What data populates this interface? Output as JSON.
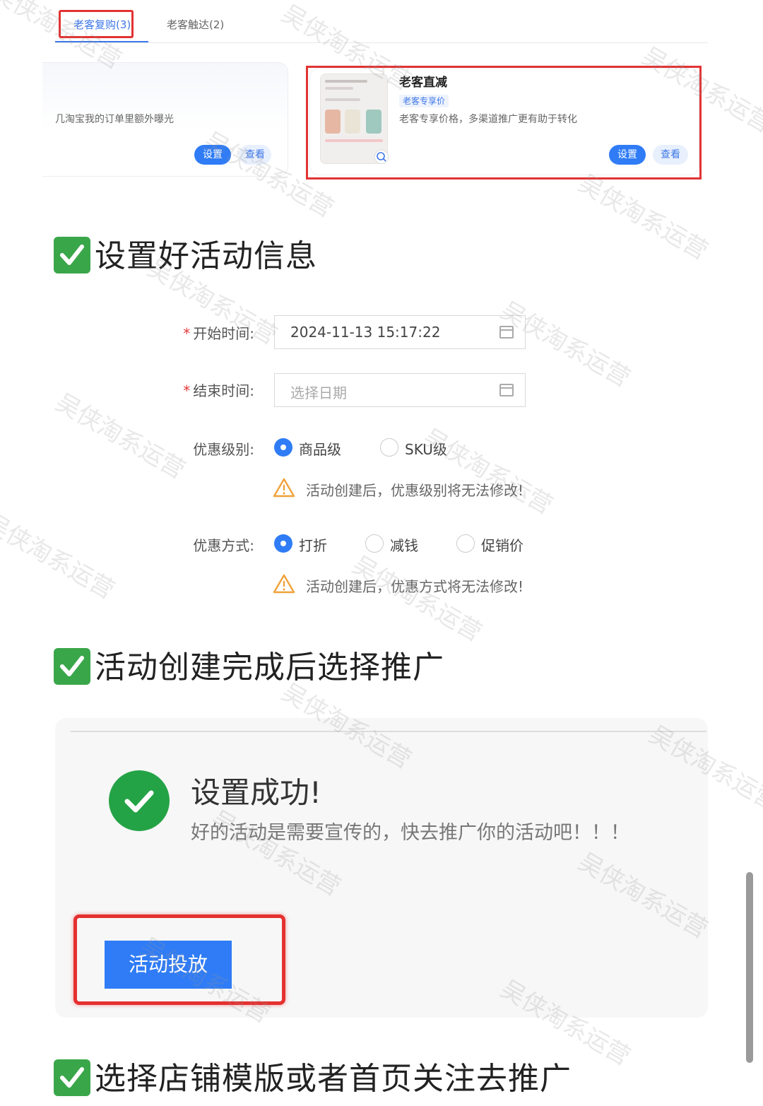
{
  "tabs": [
    {
      "label": "老客复购(3)",
      "active": true
    },
    {
      "label": "老客触达(2)",
      "active": false
    }
  ],
  "card_left": {
    "description": "几淘宝我的订单里额外曝光",
    "set_button": "设置",
    "view_button": "查看"
  },
  "card_right": {
    "title": "老客直减",
    "tag": "老客专享价",
    "description": "老客专享价格，多渠道推广更有助于转化",
    "set_button": "设置",
    "view_button": "查看"
  },
  "headings": {
    "h1": "设置好活动信息",
    "h2": "活动创建完成后选择推广",
    "h3": "选择店铺模版或者首页关注去推广"
  },
  "form": {
    "start_label": "开始时间:",
    "start_value": "2024-11-13 15:17:22",
    "end_label": "结束时间:",
    "end_placeholder": "选择日期",
    "level_label": "优惠级别:",
    "level_options": [
      "商品级",
      "SKU级"
    ],
    "level_selected": "商品级",
    "level_warning": "活动创建后，优惠级别将无法修改!",
    "method_label": "优惠方式:",
    "method_options": [
      "打折",
      "减钱",
      "促销价"
    ],
    "method_selected": "打折",
    "method_warning": "活动创建后，优惠方式将无法修改!",
    "required_mark": "*"
  },
  "success": {
    "title": "设置成功!",
    "subtitle": "好的活动是需要宣传的，快去推广你的活动吧！！！",
    "launch_button": "活动投放"
  },
  "watermark": "吴侠淘系运营",
  "colors": {
    "primary": "#2f7cf6",
    "highlight_red": "#e23333",
    "success_green": "#24a346",
    "check_green": "#3aa64a"
  }
}
